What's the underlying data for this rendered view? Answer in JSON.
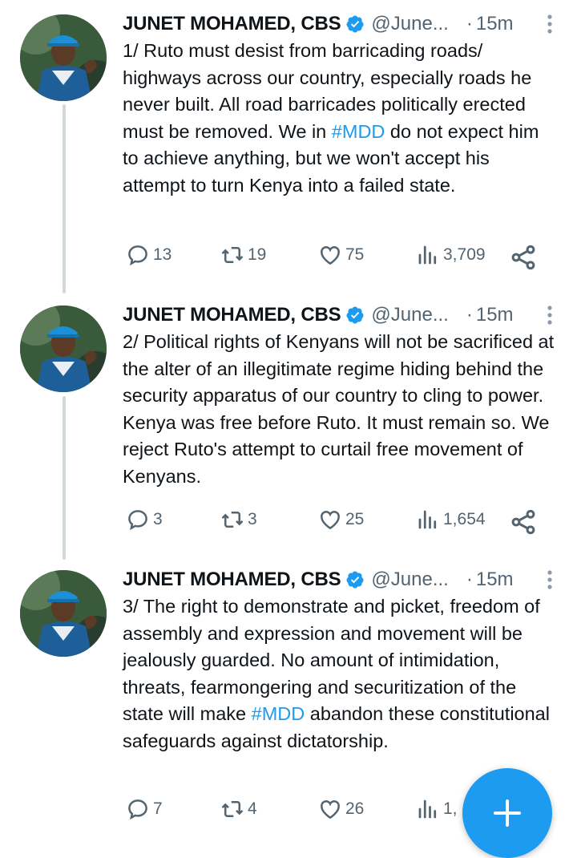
{
  "tweets": [
    {
      "name": "JUNET MOHAMED, CBS",
      "handle": "@June...",
      "dot": "·",
      "time": "15m",
      "text_parts": [
        "1/ Ruto must desist from barricading roads/ highways across our country, especially roads he never built.  All road barricades politically erected must be removed. We in ",
        "#MDD",
        " do not expect him to achieve anything, but we won't accept his attempt to turn Kenya into a failed state."
      ],
      "replies": "13",
      "retweets": "19",
      "likes": "75",
      "views": "3,709"
    },
    {
      "name": "JUNET MOHAMED, CBS",
      "handle": "@June...",
      "dot": "·",
      "time": "15m",
      "text_parts": [
        "2/ Political rights of Kenyans  will not be sacrificed at the alter of an illegitimate regime hiding behind the security apparatus of our country to cling to power. Kenya was free before Ruto. It must remain so. We reject Ruto's attempt to curtail free movement of Kenyans."
      ],
      "replies": "3",
      "retweets": "3",
      "likes": "25",
      "views": "1,654"
    },
    {
      "name": "JUNET MOHAMED, CBS",
      "handle": "@June...",
      "dot": "·",
      "time": "15m",
      "text_parts": [
        "3/ The right to demonstrate and picket, freedom of assembly and expression and movement will be jealously guarded. No amount of intimidation, threats, fearmongering and securitization of the state will make ",
        "#MDD",
        " abandon these constitutional safeguards against dictatorship."
      ],
      "replies": "7",
      "retweets": "4",
      "likes": "26",
      "views": "1,"
    }
  ],
  "colors": {
    "accent": "#1d9bf0",
    "text": "#0f1419",
    "secondary": "#536471",
    "thread_line": "#cfd9de"
  },
  "icons": [
    "reply-icon",
    "retweet-icon",
    "like-icon",
    "views-icon",
    "share-icon",
    "verified-badge-icon",
    "more-icon",
    "compose-plus-icon"
  ]
}
